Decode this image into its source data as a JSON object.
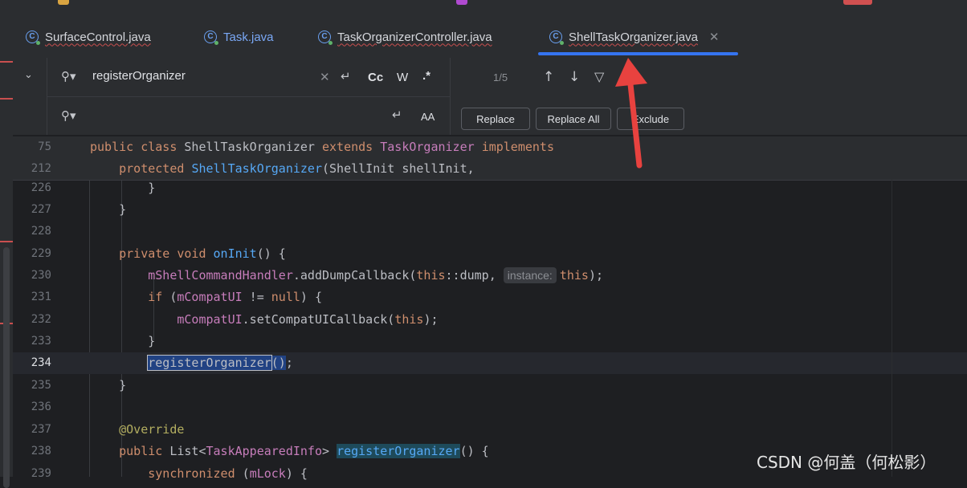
{
  "tabs": [
    {
      "label": "SurfaceControl.java",
      "active": false,
      "error": true
    },
    {
      "label": "Task.java",
      "active": false,
      "error": false
    },
    {
      "label": "TaskOrganizerController.java",
      "active": false,
      "error": true
    },
    {
      "label": "ShellTaskOrganizer.java",
      "active": true,
      "error": true
    }
  ],
  "find": {
    "search_value": "registerOrganizer",
    "replace_value": "",
    "match_counter": "1/5",
    "options": {
      "case": "Cc",
      "words": "W",
      "regex": ".*"
    },
    "preserve_case_label": "AA",
    "buttons": {
      "replace": "Replace",
      "replace_all": "Replace All",
      "exclude": "Exclude"
    }
  },
  "editor": {
    "current_line": 234,
    "lines": [
      {
        "num": "75",
        "text": "public class ShellTaskOrganizer extends TaskOrganizer implements"
      },
      {
        "num": "212",
        "text": "    protected ShellTaskOrganizer(ShellInit shellInit,"
      },
      {
        "num": "226",
        "text": "        }"
      },
      {
        "num": "227",
        "text": "    }"
      },
      {
        "num": "228",
        "text": ""
      },
      {
        "num": "229",
        "text": "    private void onInit() {"
      },
      {
        "num": "230",
        "text": "        mShellCommandHandler.addDumpCallback(this::dump, instance: this);"
      },
      {
        "num": "231",
        "text": "        if (mCompatUI != null) {"
      },
      {
        "num": "232",
        "text": "            mCompatUI.setCompatUICallback(this);"
      },
      {
        "num": "233",
        "text": "        }"
      },
      {
        "num": "234",
        "text": "        registerOrganizer();"
      },
      {
        "num": "235",
        "text": "    }"
      },
      {
        "num": "236",
        "text": ""
      },
      {
        "num": "237",
        "text": "    @Override"
      },
      {
        "num": "238",
        "text": "    public List<TaskAppearedInfo> registerOrganizer() {"
      },
      {
        "num": "239",
        "text": "        synchronized (mLock) {"
      }
    ],
    "inlay_hint": "instance:"
  },
  "watermark": "CSDN @何盖（何松影）",
  "colors": {
    "accent": "#3574f0",
    "selection": "#214283",
    "arrow": "#e8423f"
  }
}
